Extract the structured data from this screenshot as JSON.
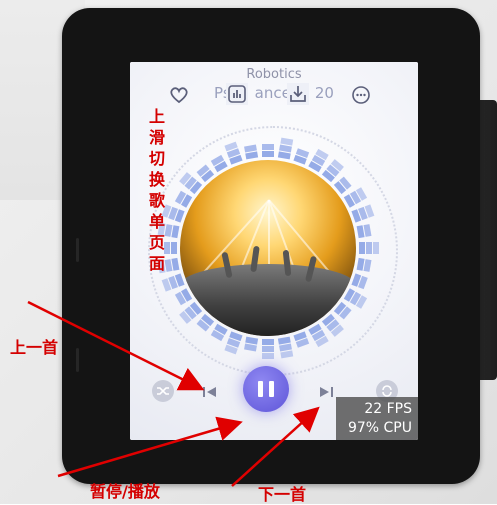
{
  "player": {
    "title": "Robotics",
    "subtitle": "Psytrance • 2020",
    "subtitle_parts": [
      "Ps",
      "ance",
      "20"
    ]
  },
  "icons": {
    "favorite": "heart-icon",
    "equalizer": "equalizer-icon",
    "download": "download-icon",
    "more": "more-dots-icon",
    "shuffle": "shuffle-icon",
    "previous": "previous-track-icon",
    "play_pause": "pause-icon",
    "next": "next-track-icon",
    "repeat": "repeat-icon"
  },
  "stats": {
    "fps": "22 FPS",
    "cpu": "97% CPU"
  },
  "annotations": {
    "swipe_up": [
      "上",
      "滑",
      "切",
      "换",
      "歌",
      "单",
      "页",
      "面"
    ],
    "previous": "上一首",
    "play_pause": "暂停/播放",
    "next": "下一首"
  },
  "colors": {
    "annotation": "#d40000",
    "accent": "#6b63e0",
    "visualizer_bar": "#8fa6e6",
    "screen_bg": "#f2f3f8",
    "device_body": "#141414"
  }
}
